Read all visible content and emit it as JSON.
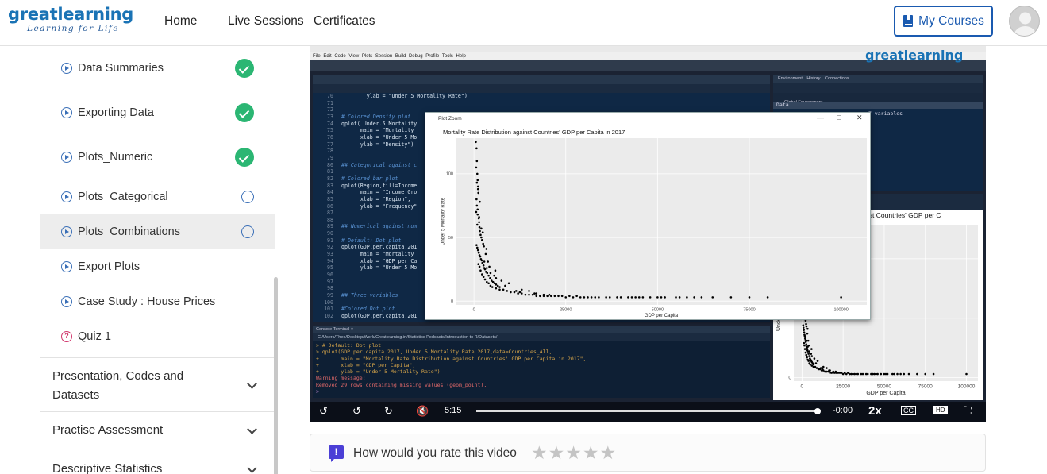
{
  "header": {
    "logo_main": "greatlearning",
    "logo_tagline": "Learning for Life",
    "nav": [
      "Home",
      "Live Sessions",
      "Certificates"
    ],
    "my_courses_label": "My Courses"
  },
  "sidebar": {
    "lessons": [
      {
        "label": "Data Summaries",
        "status": "completed",
        "icon": "play-icon"
      },
      {
        "label": "Exporting Data",
        "status": "completed",
        "icon": "play-icon"
      },
      {
        "label": "Plots_Numeric",
        "status": "completed",
        "icon": "play-icon"
      },
      {
        "label": "Plots_Categorical",
        "status": "not-started",
        "icon": "play-icon"
      },
      {
        "label": "Plots_Combinations",
        "status": "in-progress",
        "icon": "play-icon"
      },
      {
        "label": "Export Plots",
        "status": "none",
        "icon": "play-icon"
      },
      {
        "label": "Case Study : House Prices",
        "status": "none",
        "icon": "play-icon"
      },
      {
        "label": "Quiz 1",
        "status": "none",
        "icon": "quiz-icon"
      }
    ],
    "modules": [
      {
        "label": "Presentation, Codes and Datasets"
      },
      {
        "label": "Practise Assessment"
      },
      {
        "label": "Descriptive Statistics"
      }
    ]
  },
  "video": {
    "watermark": "greatlearning",
    "rstudio_menu": "File Edit Code View Plots Session Build Debug Profile Tools Help",
    "code_lines": [
      {
        "n": "70",
        "t": "        ylab = \"Under 5 Mortality Rate\")",
        "c": ""
      },
      {
        "n": "71",
        "t": "",
        "c": ""
      },
      {
        "n": "72",
        "t": "",
        "c": ""
      },
      {
        "n": "73",
        "t": "# Colored Density plot",
        "c": "cm"
      },
      {
        "n": "74",
        "t": "qplot( Under.5.Mortality",
        "c": ""
      },
      {
        "n": "75",
        "t": "      main = \"Mortality",
        "c": ""
      },
      {
        "n": "76",
        "t": "      xlab = \"Under 5 Mo",
        "c": ""
      },
      {
        "n": "77",
        "t": "      ylab = \"Density\")",
        "c": ""
      },
      {
        "n": "78",
        "t": "",
        "c": ""
      },
      {
        "n": "79",
        "t": "",
        "c": ""
      },
      {
        "n": "80",
        "t": "## Categorical against c",
        "c": "cm"
      },
      {
        "n": "81",
        "t": "",
        "c": ""
      },
      {
        "n": "82",
        "t": "# Colored bar plot",
        "c": "cm"
      },
      {
        "n": "83",
        "t": "qplot(Region,fill=Income",
        "c": ""
      },
      {
        "n": "84",
        "t": "      main = \"Income Gro",
        "c": ""
      },
      {
        "n": "85",
        "t": "      xlab = \"Region\",",
        "c": ""
      },
      {
        "n": "86",
        "t": "      ylab = \"Frequency\"",
        "c": ""
      },
      {
        "n": "87",
        "t": "",
        "c": ""
      },
      {
        "n": "88",
        "t": "",
        "c": ""
      },
      {
        "n": "89",
        "t": "## Numerical against num",
        "c": "cm"
      },
      {
        "n": "90",
        "t": "",
        "c": ""
      },
      {
        "n": "91",
        "t": "# Default: Dot plot",
        "c": "cm"
      },
      {
        "n": "92",
        "t": "qplot(GDP.per.capita.201",
        "c": ""
      },
      {
        "n": "93",
        "t": "      main = \"Mortality",
        "c": ""
      },
      {
        "n": "94",
        "t": "      xlab = \"GDP per Ca",
        "c": ""
      },
      {
        "n": "95",
        "t": "      ylab = \"Under 5 Mo",
        "c": ""
      },
      {
        "n": "96",
        "t": "",
        "c": ""
      },
      {
        "n": "97",
        "t": "",
        "c": ""
      },
      {
        "n": "98",
        "t": "",
        "c": ""
      },
      {
        "n": "99",
        "t": "## Three variables",
        "c": "cm"
      },
      {
        "n": "100",
        "t": "",
        "c": ""
      },
      {
        "n": "101",
        "t": "#Colored Dot plot",
        "c": "cm"
      },
      {
        "n": "102",
        "t": "qplot(GDP.per.capita.201",
        "c": ""
      }
    ],
    "console_tabs": "Console   Terminal ×",
    "console_path": "C:/Users/Theo/Desktop/Work/Greatlearning.in/Statistics Podcasts/Introduction to R/Datasets/",
    "console_lines": [
      {
        "t": "> # Default: Dot plot",
        "c": ""
      },
      {
        "t": "> qplot(GDP.per.capita.2017, Under.5.Mortality.Rate.2017,data=Countries_All,",
        "c": ""
      },
      {
        "t": "+       main = \"Mortality Rate Distribution against Countries' GDP per Capita in 2017\",",
        "c": ""
      },
      {
        "t": "+       xlab = \"GDP per Capita\",",
        "c": ""
      },
      {
        "t": "+       ylab = \"Under 5 Mortality Rate\")",
        "c": ""
      },
      {
        "t": "Warning message:",
        "c": "w"
      },
      {
        "t": "Removed 29 rows containing missing values (geom_point).",
        "c": "w"
      },
      {
        "t": "> ",
        "c": "p"
      }
    ],
    "env_tabs": "Environment History Connections",
    "env_global": "Global Environment",
    "env_data_label": "Data",
    "env_row": "7 variables",
    "plots_title_fragment": "against Countries' GDP per C",
    "plot_zoom": {
      "window_title": "Plot Zoom",
      "controls": [
        "—",
        "□",
        "✕"
      ]
    },
    "time_current": "5:15",
    "time_remaining": "-0:00",
    "speed": "2x",
    "progress": 1.0
  },
  "chart_data": [
    {
      "type": "scatter",
      "title": "Mortality Rate Distribution against Countries' GDP per Capita in 2017",
      "xlabel": "GDP per Capita",
      "ylabel": "Under 5 Mortality Rate",
      "xlim": [
        -5000,
        107000
      ],
      "ylim": [
        -3,
        128
      ],
      "xticks": [
        0,
        25000,
        50000,
        75000,
        100000
      ],
      "yticks": [
        0,
        50,
        100
      ],
      "xtick_labels": [
        "0",
        "25000",
        "50000",
        "75000",
        "100000"
      ],
      "ytick_labels": [
        "0",
        "50",
        "100"
      ],
      "x": [
        500,
        700,
        800,
        600,
        900,
        1000,
        1100,
        1200,
        700,
        800,
        600,
        1000,
        1300,
        1400,
        900,
        1500,
        1600,
        1800,
        2000,
        2200,
        2500,
        700,
        900,
        1100,
        1300,
        1500,
        1700,
        1900,
        2100,
        2300,
        2600,
        2800,
        3000,
        3300,
        3600,
        4000,
        4400,
        4800,
        5200,
        5600,
        6000,
        6500,
        7000,
        1200,
        1500,
        1800,
        2200,
        2600,
        3000,
        3500,
        4000,
        4500,
        5000,
        6000,
        7000,
        8000,
        9000,
        10000,
        11000,
        12000,
        13000,
        14000,
        15000,
        16000,
        17000,
        18000,
        19000,
        20000,
        21000,
        23000,
        25000,
        27000,
        29000,
        31000,
        33000,
        36000,
        39000,
        42000,
        45000,
        48000,
        52000,
        56000,
        60000,
        65000,
        70000,
        75000,
        80000,
        100000,
        9500,
        13000,
        15000,
        6000,
        4500,
        3500,
        2800,
        17000,
        19000,
        24000,
        28000,
        34000,
        40000,
        46000,
        50000,
        55000,
        62000,
        1000,
        1400,
        2000,
        2700,
        3200,
        3800,
        4200,
        5500,
        8500,
        11500,
        22000,
        26000,
        30000,
        37000,
        44000,
        51000,
        58000,
        800,
        1100,
        1600,
        2400,
        3400,
        5800,
        7500,
        12500,
        16500,
        20500,
        32000,
        43000
      ],
      "y": [
        125,
        120,
        110,
        105,
        100,
        95,
        90,
        85,
        80,
        75,
        70,
        68,
        65,
        62,
        60,
        58,
        55,
        52,
        50,
        48,
        45,
        44,
        42,
        40,
        38,
        36,
        35,
        33,
        32,
        30,
        28,
        26,
        25,
        23,
        22,
        20,
        18,
        16,
        15,
        14,
        13,
        12,
        11,
        29,
        27,
        24,
        21,
        19,
        17,
        15,
        14,
        12,
        11,
        10,
        9,
        9,
        8,
        7,
        7,
        6,
        6,
        5,
        5,
        5,
        4,
        4,
        4,
        4,
        4,
        4,
        3,
        3,
        3,
        3,
        3,
        3,
        3,
        3,
        3,
        3,
        3,
        3,
        3,
        3,
        3,
        3,
        3,
        3,
        14,
        9,
        8,
        18,
        22,
        26,
        31,
        6,
        5,
        4,
        4,
        3,
        3,
        3,
        3,
        3,
        3,
        72,
        66,
        57,
        43,
        37,
        31,
        27,
        20,
        12,
        8,
        4,
        4,
        3,
        3,
        3,
        3,
        3,
        93,
        88,
        78,
        54,
        41,
        24,
        16,
        7,
        6,
        5,
        3,
        3
      ]
    }
  ],
  "rating": {
    "prompt": "How would you rate this video",
    "stars": 0,
    "max_stars": 5
  },
  "colors": {
    "brand_blue": "#1a73b5",
    "complete_green": "#2bb673",
    "rating_icon": "#4b3fd6"
  }
}
